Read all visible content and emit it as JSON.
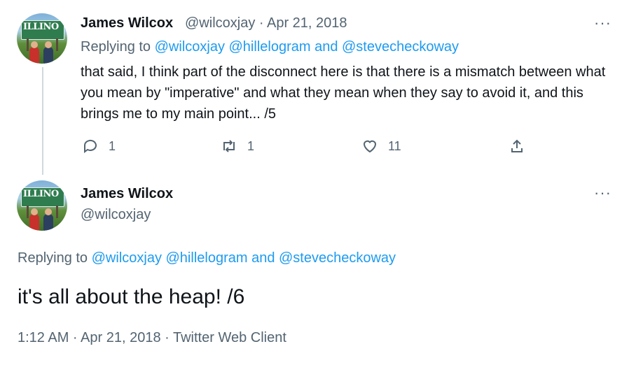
{
  "tweet1": {
    "name": "James Wilcox",
    "handle_date": "@wilcoxjay · Apr 21, 2018",
    "replying_prefix": "Replying to",
    "replying_links": "@wilcoxjay @hillelogram and @stevecheckoway",
    "text": "that said, I think part of the disconnect here is that there is a mismatch between what you mean by \"imperative\" and what they mean when they say to avoid it, and this brings me to my main point... /5",
    "counts": {
      "reply": "1",
      "retweet": "1",
      "like": "11"
    }
  },
  "tweet2": {
    "name": "James Wilcox",
    "handle": "@wilcoxjay",
    "replying_prefix": "Replying to",
    "replying_links": "@wilcoxjay @hillelogram and @stevecheckoway",
    "text": "it's all about the heap! /6",
    "timestamp": "1:12 AM · Apr 21, 2018 · Twitter Web Client"
  },
  "avatar_sign_text": "ILLINO",
  "more_icon": "···",
  "colors": {
    "link": "#1d9bf0",
    "muted": "#536471",
    "text": "#0f1419",
    "thread_line": "#cfd9de"
  }
}
